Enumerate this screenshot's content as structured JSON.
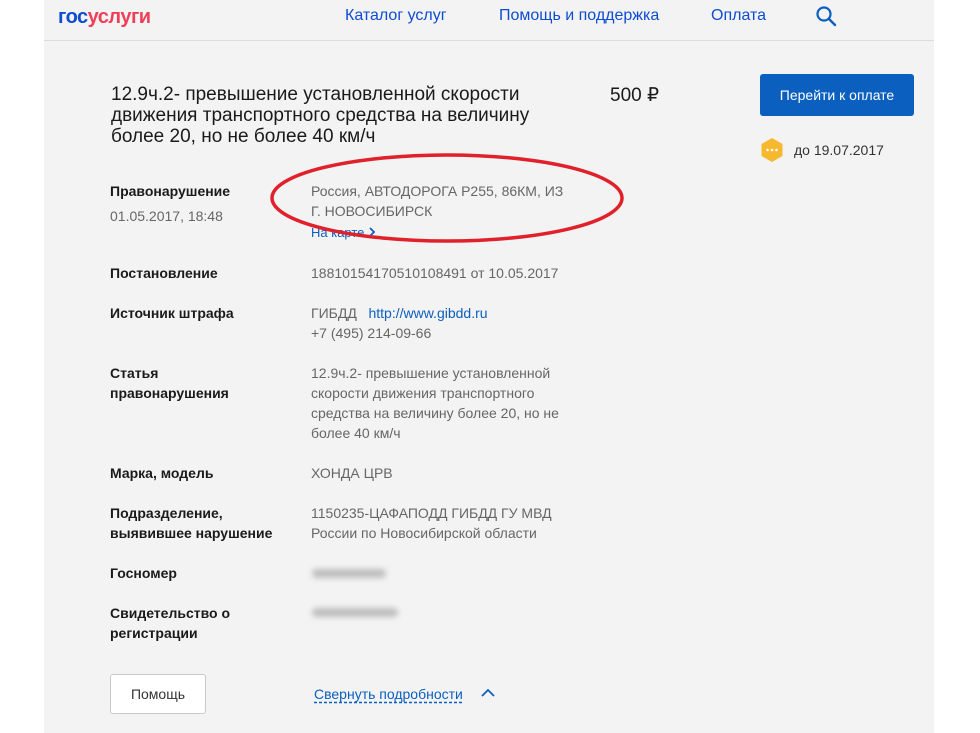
{
  "header": {
    "logo_part1": "гос",
    "logo_part2": "услуги",
    "nav": [
      "Каталог услуг",
      "Помощь и поддержка",
      "Оплата"
    ]
  },
  "fine": {
    "title": "12.9ч.2- превышение установленной скорости движения транспортного средства на величину более 20, но не более 40 км/ч",
    "amount": "500 ₽",
    "pay_button": "Перейти к оплате",
    "deadline": "до 19.07.2017"
  },
  "details": {
    "violation_label": "Правонарушение",
    "violation_datetime": "01.05.2017, 18:48",
    "violation_place_1": "Россия, АВТОДОРОГА Р255, 86КМ, ИЗ",
    "violation_place_2": "Г. НОВОСИБИРСК",
    "on_map": "На карте",
    "decree_label": "Постановление",
    "decree_value": "18810154170510108491 от 10.05.2017",
    "source_label": "Источник штрафа",
    "source_name": "ГИБДД",
    "source_url": "http://www.gibdd.ru",
    "source_phone": "+7 (495) 214-09-66",
    "article_label_1": "Статья",
    "article_label_2": "правонарушения",
    "article_lines": [
      "12.9ч.2- превышение установленной",
      "скорости движения транспортного",
      "средства на величину более 20, но не",
      "более 40 км/ч"
    ],
    "model_label": "Марка, модель",
    "model_value": "ХОНДА ЦРВ",
    "division_label_1": "Подразделение,",
    "division_label_2": "выявившее нарушение",
    "division_value_1": "1150235-ЦАФАПОДД ГИБДД ГУ МВД",
    "division_value_2": "России по Новосибирской области",
    "plate_label": "Госномер",
    "cert_label_1": "Свидетельство о",
    "cert_label_2": "регистрации"
  },
  "footer": {
    "help_button": "Помощь",
    "collapse_link": "Свернуть подробности"
  },
  "colors": {
    "brand_blue": "#0d4cd3",
    "brand_red": "#ee3f58",
    "button_blue": "#0b5fbf",
    "annotation_red": "#e0202a",
    "deadline_badge": "#f5b82e"
  },
  "icons": [
    "search-icon",
    "deadline-badge-icon",
    "chevron-right-icon",
    "chevron-up-icon"
  ]
}
